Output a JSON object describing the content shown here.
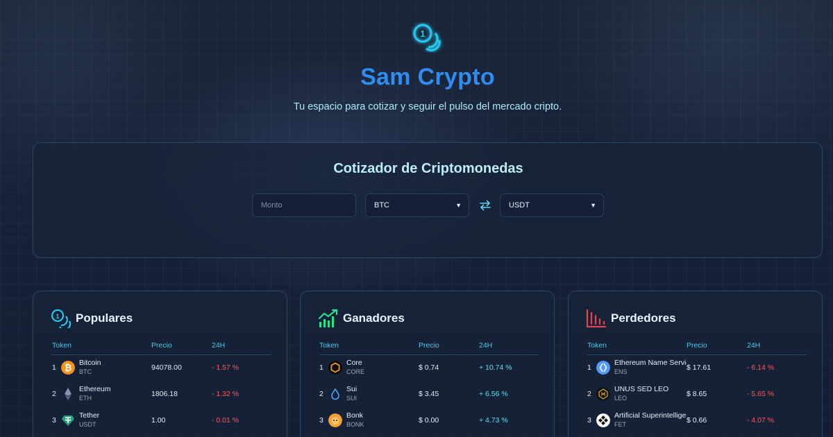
{
  "brand": {
    "title": "Sam Crypto",
    "tagline": "Tu espacio para cotizar y seguir el pulso del mercado cripto."
  },
  "quoter": {
    "title": "Cotizador de Criptomonedas",
    "amount_placeholder": "Monto",
    "from_currency": "BTC",
    "to_currency": "USDT"
  },
  "cards": [
    {
      "title": "Populares",
      "icon": "coins-icon",
      "headers": {
        "token": "Token",
        "price": "Precio",
        "change": "24H"
      },
      "rows": [
        {
          "rank": "1",
          "name": "Bitcoin",
          "symbol": "BTC",
          "price": "94078.00",
          "change": "- 1.57 %",
          "direction": "down",
          "icon": "bitcoin-icon",
          "color": "#f7931a"
        },
        {
          "rank": "2",
          "name": "Ethereum",
          "symbol": "ETH",
          "price": "1806.18",
          "change": "- 1.32 %",
          "direction": "down",
          "icon": "ethereum-icon",
          "color": "#8a92b2"
        },
        {
          "rank": "3",
          "name": "Tether",
          "symbol": "USDT",
          "price": "1.00",
          "change": "- 0.01 %",
          "direction": "down",
          "icon": "tether-icon",
          "color": "#26a17b"
        }
      ]
    },
    {
      "title": "Ganadores",
      "icon": "chart-up-icon",
      "headers": {
        "token": "Token",
        "price": "Precio",
        "change": "24H"
      },
      "rows": [
        {
          "rank": "1",
          "name": "Core",
          "symbol": "CORE",
          "price": "$ 0.74",
          "change": "+ 10.74 %",
          "direction": "up",
          "icon": "core-icon",
          "color": "#f79a1f"
        },
        {
          "rank": "2",
          "name": "Sui",
          "symbol": "SUI",
          "price": "$ 3.45",
          "change": "+ 6.56 %",
          "direction": "up",
          "icon": "sui-icon",
          "color": "#4da2ff"
        },
        {
          "rank": "3",
          "name": "Bonk",
          "symbol": "BONK",
          "price": "$ 0.00",
          "change": "+ 4.73 %",
          "direction": "up",
          "icon": "bonk-icon",
          "color": "#f2a03a"
        }
      ]
    },
    {
      "title": "Perdedores",
      "icon": "chart-down-icon",
      "headers": {
        "token": "Token",
        "price": "Precio",
        "change": "24H"
      },
      "rows": [
        {
          "rank": "1",
          "name": "Ethereum Name Service",
          "symbol": "ENS",
          "price": "$ 17.61",
          "change": "- 6.14 %",
          "direction": "down",
          "icon": "ens-icon",
          "color": "#5298ff"
        },
        {
          "rank": "2",
          "name": "UNUS SED LEO",
          "symbol": "LEO",
          "price": "$ 8.65",
          "change": "- 5.65 %",
          "direction": "down",
          "icon": "leo-icon",
          "color": "#d9a520"
        },
        {
          "rank": "3",
          "name": "Artificial Superintelligence Alliance",
          "symbol": "FET",
          "price": "$ 0.66",
          "change": "- 4.07 %",
          "direction": "down",
          "icon": "fet-icon",
          "color": "#ffffff"
        }
      ]
    }
  ],
  "colors": {
    "accent": "#2f8cf0",
    "cyan": "#4fc7e8",
    "negative": "#ff5a5a",
    "positive": "#5fe0f0",
    "gain_icon": "#2ee08a",
    "loss_icon": "#e8414f"
  }
}
